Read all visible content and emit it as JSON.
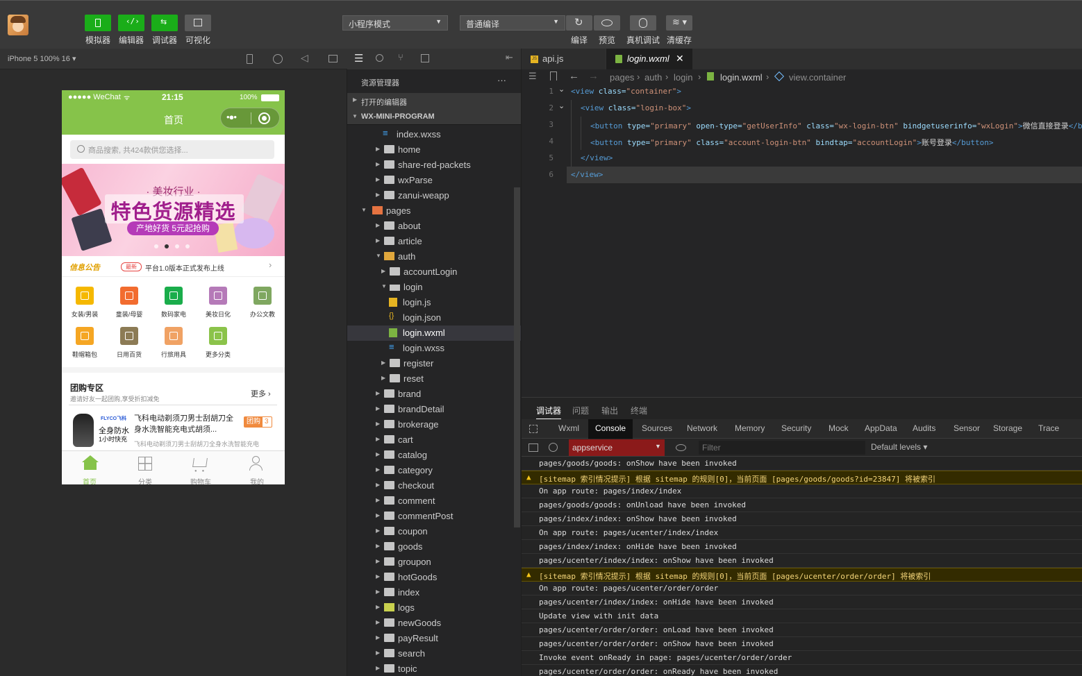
{
  "toolbar": {
    "buttons": [
      {
        "label": "模拟器"
      },
      {
        "label": "编辑器"
      },
      {
        "label": "调试器"
      },
      {
        "label": "可视化"
      },
      {
        "label": "编译"
      },
      {
        "label": "预览"
      },
      {
        "label": "真机调试"
      },
      {
        "label": "清缓存"
      }
    ],
    "mode_select": "小程序模式",
    "compile_select": "普通编译"
  },
  "simulator": {
    "device": "iPhone 5 100% 16 ▾",
    "status_left": "●●●●● WeChat",
    "status_time": "21:15",
    "status_battery": "100%",
    "page_title": "首页",
    "search_placeholder": "商品搜索, 共424款供您选择...",
    "banner_small": "· 美妆行业 ·",
    "banner_big": "特色货源精选",
    "banner_sub": "产地好货 5元起抢购",
    "notice_title": "信息公告",
    "notice_badge": "最新",
    "notice_text": "平台1.0版本正式发布上线",
    "categories": [
      {
        "label": "女装/男装"
      },
      {
        "label": "童装/母婴"
      },
      {
        "label": "数码家电"
      },
      {
        "label": "美妆日化"
      },
      {
        "label": "办公文教"
      },
      {
        "label": "鞋帽箱包"
      },
      {
        "label": "日用百货"
      },
      {
        "label": "行旅用具"
      },
      {
        "label": "更多分类"
      }
    ],
    "group_title": "团购专区",
    "group_sub": "邀请好友一起团购,享受折扣减免",
    "group_more": "更多",
    "product_title": "飞科电动剃须刀男士刮胡刀全身水洗智能充电式胡须...",
    "product_desc": "飞科电动剃须刀男士刮胡刀全身水洗智能充电",
    "product_badge": "团购",
    "product_badge_num": "3",
    "product_img_text1": "全身防水",
    "product_img_text2": "1小时快充",
    "product_brand": "FLYCO飞科",
    "tabbar": [
      {
        "label": "首页"
      },
      {
        "label": "分类"
      },
      {
        "label": "购物车"
      },
      {
        "label": "我的"
      }
    ]
  },
  "explorer": {
    "title": "资源管理器",
    "more": "···",
    "open_editors": "打开的编辑器",
    "project": "WX-MINI-PROGRAM",
    "items": [
      {
        "label": "index.wxss",
        "type": "wxss",
        "depth": 2
      },
      {
        "label": "home",
        "type": "folder",
        "depth": 1
      },
      {
        "label": "share-red-packets",
        "type": "folder",
        "depth": 1
      },
      {
        "label": "wxParse",
        "type": "folder",
        "depth": 1
      },
      {
        "label": "zanui-weapp",
        "type": "folder",
        "depth": 1
      },
      {
        "label": "pages",
        "type": "folder-open-pages",
        "depth": 0
      },
      {
        "label": "about",
        "type": "folder",
        "depth": 1
      },
      {
        "label": "article",
        "type": "folder",
        "depth": 1
      },
      {
        "label": "auth",
        "type": "folder-open",
        "depth": 1
      },
      {
        "label": "accountLogin",
        "type": "folder",
        "depth": 2
      },
      {
        "label": "login",
        "type": "folder-open-plain",
        "depth": 2
      },
      {
        "label": "login.js",
        "type": "js",
        "depth": 3
      },
      {
        "label": "login.json",
        "type": "json",
        "depth": 3
      },
      {
        "label": "login.wxml",
        "type": "wxml",
        "depth": 3
      },
      {
        "label": "login.wxss",
        "type": "wxss",
        "depth": 3
      },
      {
        "label": "register",
        "type": "folder",
        "depth": 2
      },
      {
        "label": "reset",
        "type": "folder",
        "depth": 2
      },
      {
        "label": "brand",
        "type": "folder",
        "depth": 1
      },
      {
        "label": "brandDetail",
        "type": "folder",
        "depth": 1
      },
      {
        "label": "brokerage",
        "type": "folder",
        "depth": 1
      },
      {
        "label": "cart",
        "type": "folder",
        "depth": 1
      },
      {
        "label": "catalog",
        "type": "folder",
        "depth": 1
      },
      {
        "label": "category",
        "type": "folder",
        "depth": 1
      },
      {
        "label": "checkout",
        "type": "folder",
        "depth": 1
      },
      {
        "label": "comment",
        "type": "folder",
        "depth": 1
      },
      {
        "label": "commentPost",
        "type": "folder",
        "depth": 1
      },
      {
        "label": "coupon",
        "type": "folder",
        "depth": 1
      },
      {
        "label": "goods",
        "type": "folder",
        "depth": 1
      },
      {
        "label": "groupon",
        "type": "folder",
        "depth": 1
      },
      {
        "label": "hotGoods",
        "type": "folder",
        "depth": 1
      },
      {
        "label": "index",
        "type": "folder",
        "depth": 1
      },
      {
        "label": "logs",
        "type": "folder-logs",
        "depth": 1
      },
      {
        "label": "newGoods",
        "type": "folder",
        "depth": 1
      },
      {
        "label": "payResult",
        "type": "folder",
        "depth": 1
      },
      {
        "label": "search",
        "type": "folder",
        "depth": 1
      },
      {
        "label": "topic",
        "type": "folder",
        "depth": 1
      }
    ]
  },
  "editor": {
    "tabs": [
      {
        "label": "api.js"
      },
      {
        "label": "login.wxml"
      }
    ],
    "breadcrumb": [
      "pages",
      "auth",
      "login",
      "login.wxml",
      "view.container"
    ],
    "lines": [
      {
        "n": "1",
        "parts": [
          [
            "tg",
            "<view "
          ],
          [
            "at",
            "class="
          ],
          [
            "st",
            "\"container\""
          ],
          [
            "tg",
            ">"
          ]
        ]
      },
      {
        "n": "2",
        "parts": [
          [
            "tg",
            "<view "
          ],
          [
            "at",
            "class="
          ],
          [
            "st",
            "\"login-box\""
          ],
          [
            "tg",
            ">"
          ]
        ]
      },
      {
        "n": "3",
        "parts": [
          [
            "tg",
            "<button "
          ],
          [
            "at",
            "type="
          ],
          [
            "st",
            "\"primary\" "
          ],
          [
            "at",
            "open-type="
          ],
          [
            "st",
            "\"getUserInfo\" "
          ],
          [
            "at",
            "class="
          ],
          [
            "st",
            "\"wx-login-btn\" "
          ],
          [
            "at",
            "bindgetuserinfo="
          ],
          [
            "st",
            "\"wxLogin\""
          ],
          [
            "tg",
            ">"
          ],
          [
            "tx",
            "微信直接登录"
          ],
          [
            "tg",
            "</b"
          ]
        ]
      },
      {
        "n": "4",
        "parts": [
          [
            "tg",
            "<button "
          ],
          [
            "at",
            "type="
          ],
          [
            "st",
            "\"primary\" "
          ],
          [
            "at",
            "class="
          ],
          [
            "st",
            "\"account-login-btn\" "
          ],
          [
            "at",
            "bindtap="
          ],
          [
            "st",
            "\"accountLogin\""
          ],
          [
            "tg",
            ">"
          ],
          [
            "tx",
            "账号登录"
          ],
          [
            "tg",
            "</button>"
          ]
        ]
      },
      {
        "n": "5",
        "parts": [
          [
            "tg",
            "</view>"
          ]
        ]
      },
      {
        "n": "6",
        "parts": [
          [
            "tg",
            "</view>"
          ]
        ]
      }
    ]
  },
  "debug": {
    "top_tabs": [
      "调试器",
      "问题",
      "输出",
      "终端"
    ],
    "tabs": [
      "Wxml",
      "Console",
      "Sources",
      "Network",
      "Memory",
      "Security",
      "Mock",
      "AppData",
      "Audits",
      "Sensor",
      "Storage",
      "Trace"
    ],
    "context": "appservice",
    "filter_placeholder": "Filter",
    "levels": "Default levels ▾",
    "logs": [
      {
        "text": "pages/goods/goods: onShow have been invoked",
        "warn": false
      },
      {
        "text": "[sitemap 索引情况提示] 根据 sitemap 的规则[0]，当前页面 [pages/goods/goods?id=23847] 将被索引",
        "warn": true
      },
      {
        "text": "On app route: pages/index/index",
        "warn": false
      },
      {
        "text": "pages/goods/goods: onUnload have been invoked",
        "warn": false
      },
      {
        "text": "pages/index/index: onShow have been invoked",
        "warn": false
      },
      {
        "text": "On app route: pages/ucenter/index/index",
        "warn": false
      },
      {
        "text": "pages/index/index: onHide have been invoked",
        "warn": false
      },
      {
        "text": "pages/ucenter/index/index: onShow have been invoked",
        "warn": false
      },
      {
        "text": "[sitemap 索引情况提示] 根据 sitemap 的规则[0]，当前页面 [pages/ucenter/order/order] 将被索引",
        "warn": true
      },
      {
        "text": "On app route: pages/ucenter/order/order",
        "warn": false
      },
      {
        "text": "pages/ucenter/index/index: onHide have been invoked",
        "warn": false
      },
      {
        "text": "Update view with init data",
        "warn": false
      },
      {
        "text": "pages/ucenter/order/order: onLoad have been invoked",
        "warn": false
      },
      {
        "text": "pages/ucenter/order/order: onShow have been invoked",
        "warn": false
      },
      {
        "text": "Invoke event onReady in page: pages/ucenter/order/order",
        "warn": false
      },
      {
        "text": "pages/ucenter/order/order: onReady have been invoked",
        "warn": false
      }
    ]
  }
}
